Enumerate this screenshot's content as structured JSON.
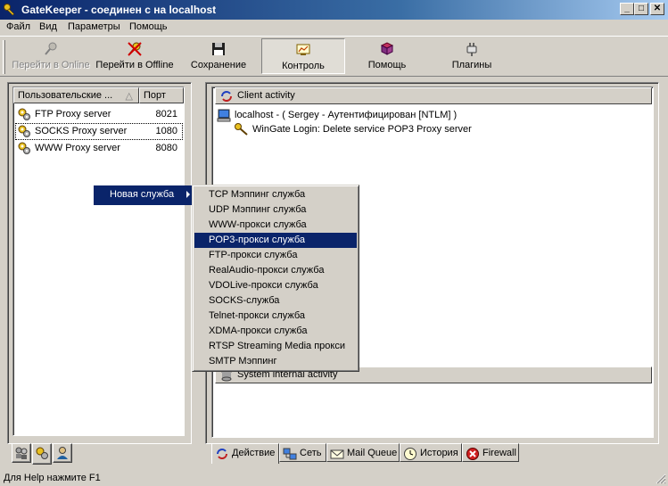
{
  "window": {
    "title": "GateKeeper - соединен с на localhost",
    "min_glyph": "_",
    "max_glyph": "□",
    "close_glyph": "✕"
  },
  "menu": [
    "Файл",
    "Вид",
    "Параметры",
    "Помощь"
  ],
  "toolbar": {
    "go_online": "Перейти в Online",
    "go_offline": "Перейти в Offline",
    "save": "Сохранение",
    "control": "Контроль",
    "help": "Помощь",
    "plugins": "Плагины"
  },
  "services": {
    "col_name": "Пользовательские ...",
    "col_port": "Порт",
    "rows": [
      {
        "name": "FTP Proxy server",
        "port": "8021"
      },
      {
        "name": "SOCKS Proxy server",
        "port": "1080"
      },
      {
        "name": "WWW Proxy server",
        "port": "8080"
      }
    ]
  },
  "activity": {
    "client_header": "Client activity",
    "client_line": "localhost  -  ( Sergey  -  Аутентифицирован [NTLM] )",
    "sub_line": "WinGate Login: Delete service POP3 Proxy server",
    "system_header": "System internal activity"
  },
  "tabs": [
    "Действие",
    "Сеть",
    "Mail Queue",
    "История",
    "Firewall"
  ],
  "context_menu": {
    "parent": "Новая служба",
    "items": [
      "TCP Мэппинг служба",
      "UDP Мэппинг служба",
      "WWW-прокси служба",
      "POP3-прокси служба",
      "FTP-прокси служба",
      "RealAudio-прокси служба",
      "VDOLive-прокси служба",
      "SOCKS-служба",
      "Telnet-прокси служба",
      "XDMA-прокси служба",
      "RTSP Streaming Media прокси",
      "SMTP Мэппинг"
    ],
    "highlighted_index": 3
  },
  "status": "Для Help нажмите F1",
  "colors": {
    "selection": "#0a246a",
    "face": "#d4d0c8"
  }
}
